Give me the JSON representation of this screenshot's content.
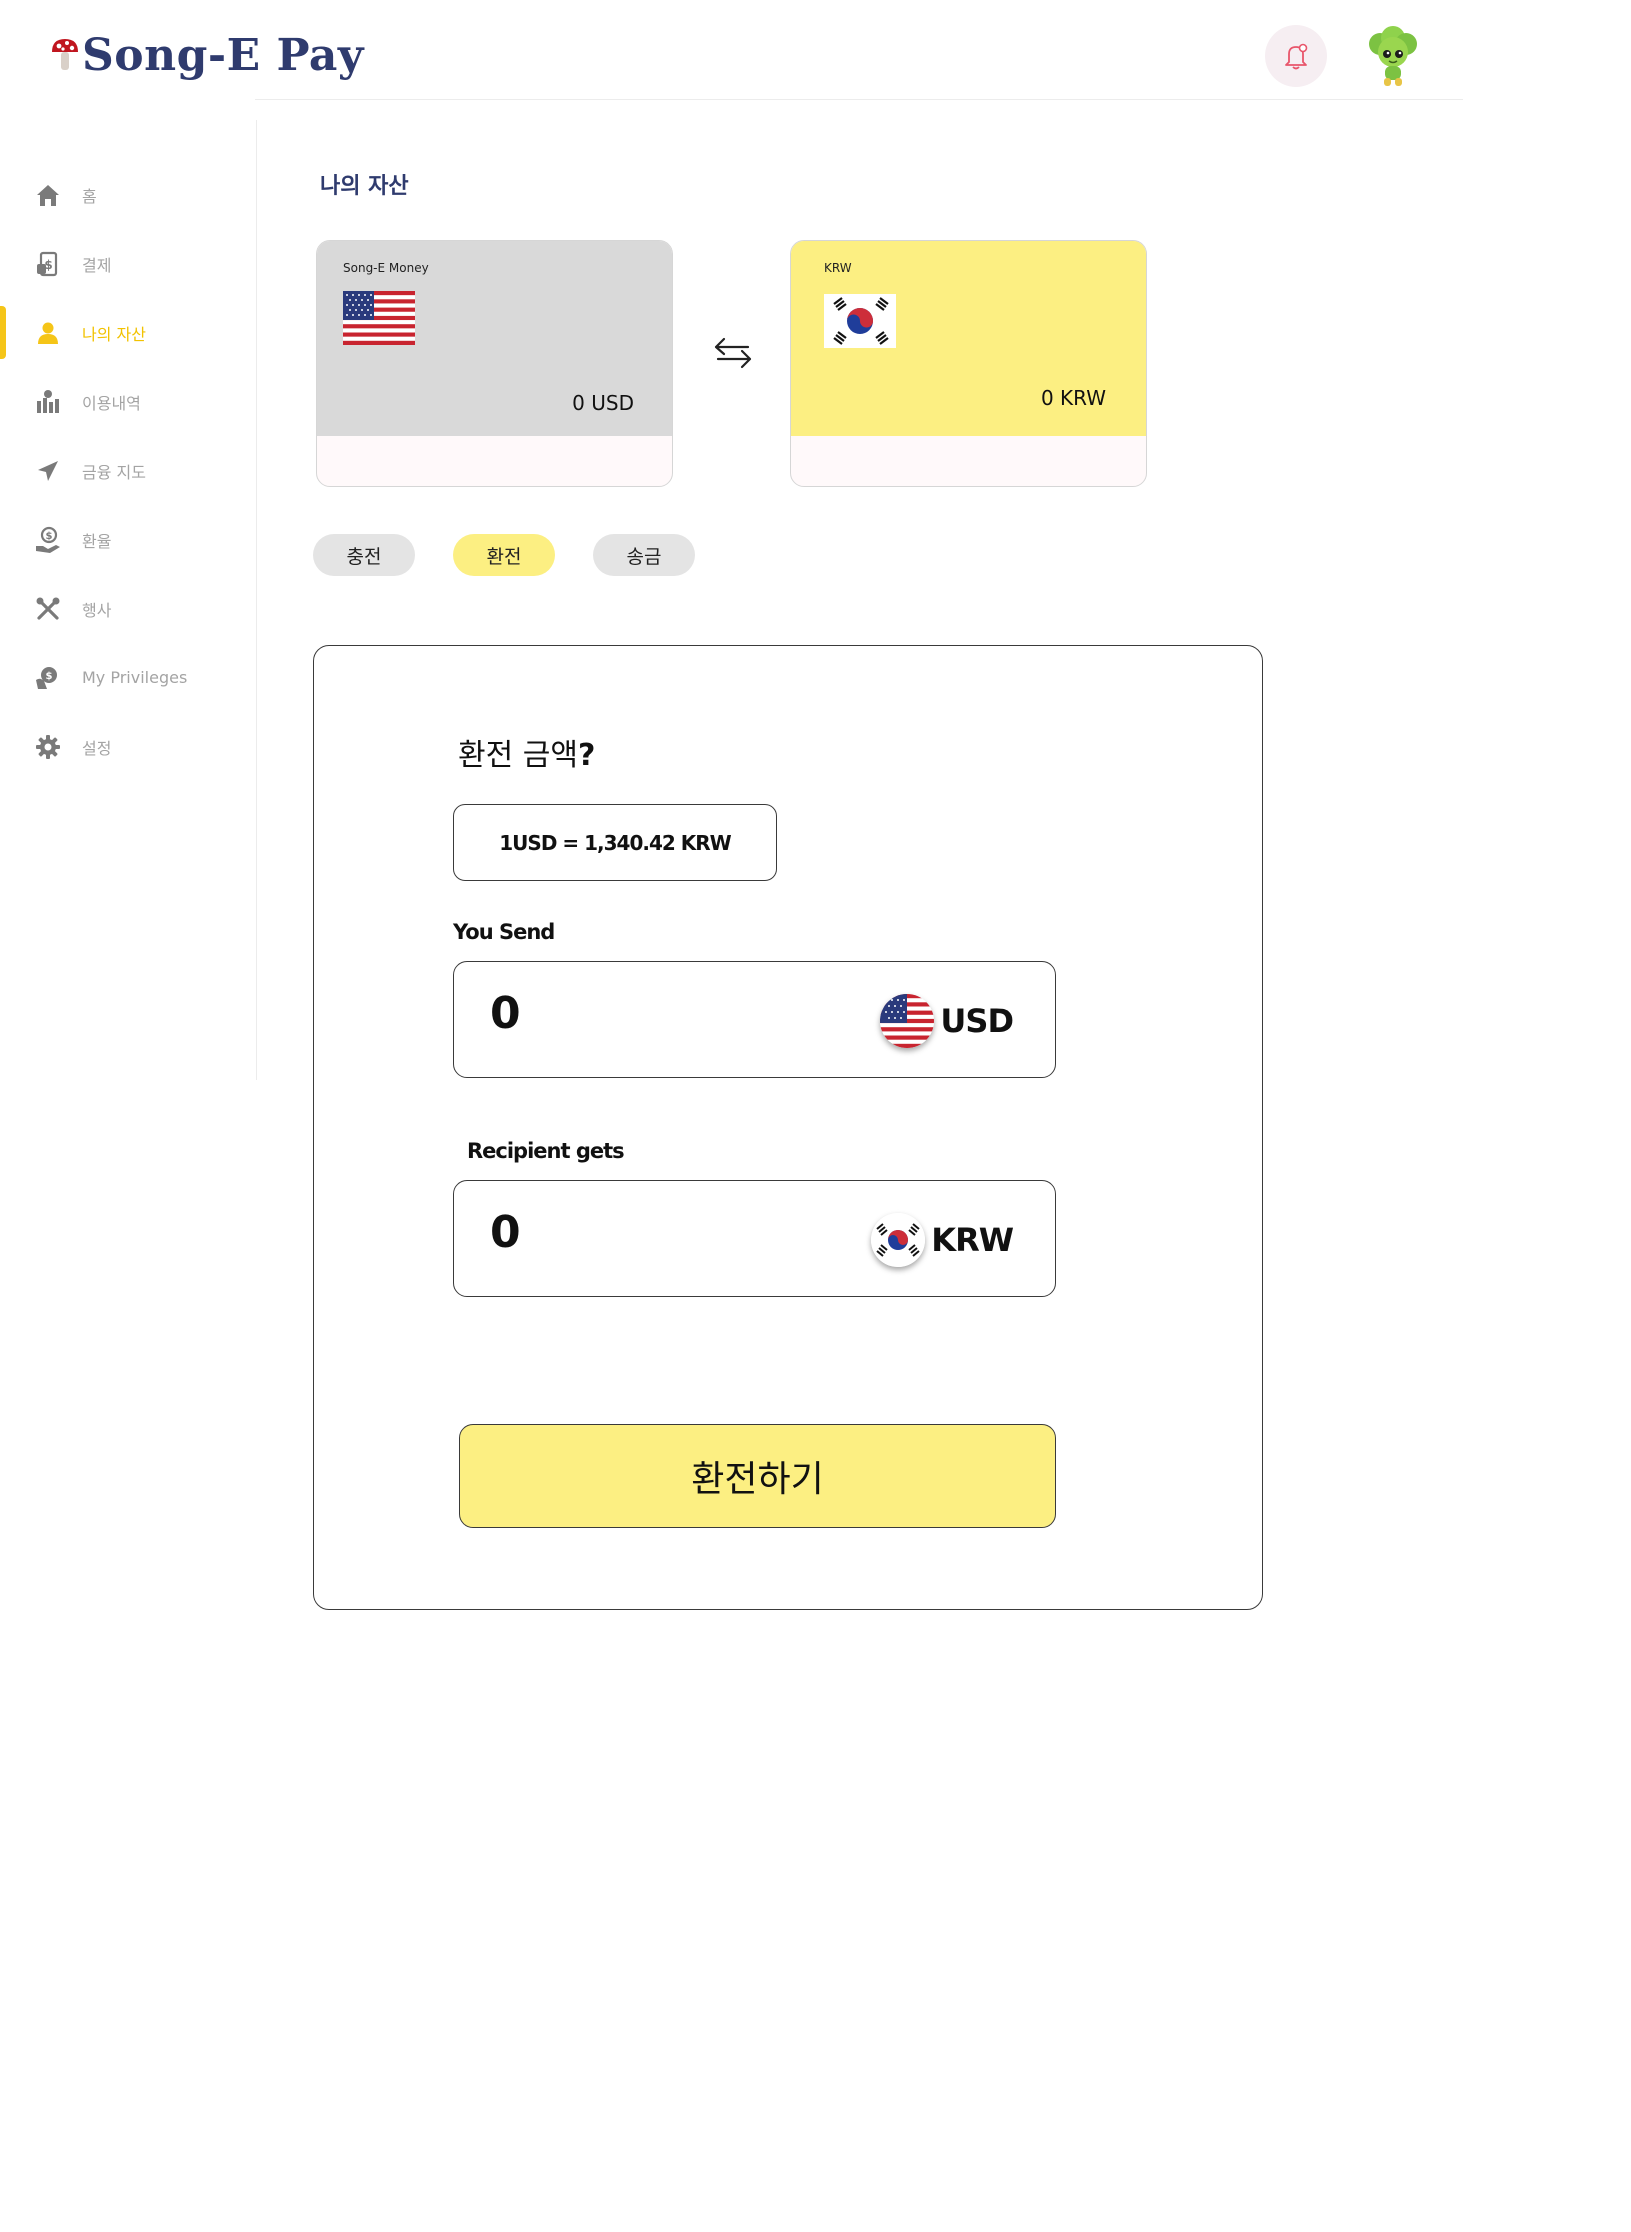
{
  "app": {
    "name": "Song-E Pay"
  },
  "sidebar": {
    "items": [
      {
        "label": "홈",
        "icon": "home-icon"
      },
      {
        "label": "결제",
        "icon": "payment-icon"
      },
      {
        "label": "나의 자산",
        "icon": "user-icon",
        "active": true
      },
      {
        "label": "이용내역",
        "icon": "history-icon"
      },
      {
        "label": "금융 지도",
        "icon": "send-icon"
      },
      {
        "label": "환율",
        "icon": "exchange-rate-icon"
      },
      {
        "label": "행사",
        "icon": "tools-icon"
      },
      {
        "label": "My Privileges",
        "icon": "privileges-icon"
      },
      {
        "label": "설정",
        "icon": "gear-icon"
      }
    ]
  },
  "assets": {
    "title": "나의 자산",
    "cards": [
      {
        "name": "Song-E Money",
        "balance": "0 USD",
        "flag": "us-flag-icon"
      },
      {
        "name": "KRW",
        "balance": "0 KRW",
        "flag": "kr-flag-icon"
      }
    ]
  },
  "tabs": [
    {
      "label": "충전",
      "active": false
    },
    {
      "label": "환전",
      "active": true
    },
    {
      "label": "송금",
      "active": false
    }
  ],
  "exchange": {
    "question": "환전 금액",
    "question_mark": "?",
    "rate": "1USD = 1,340.42 KRW",
    "send_label": "You Send",
    "send_value": "0",
    "send_currency": "USD",
    "receive_label": "Recipient gets",
    "receive_value": "0",
    "receive_currency": "KRW",
    "button_label": "환전하기"
  },
  "colors": {
    "brand": "#2f3b6e",
    "accent_yellow": "#fcef82",
    "active_sidebar": "#f2c200",
    "card_gray": "#d9d9d9"
  }
}
